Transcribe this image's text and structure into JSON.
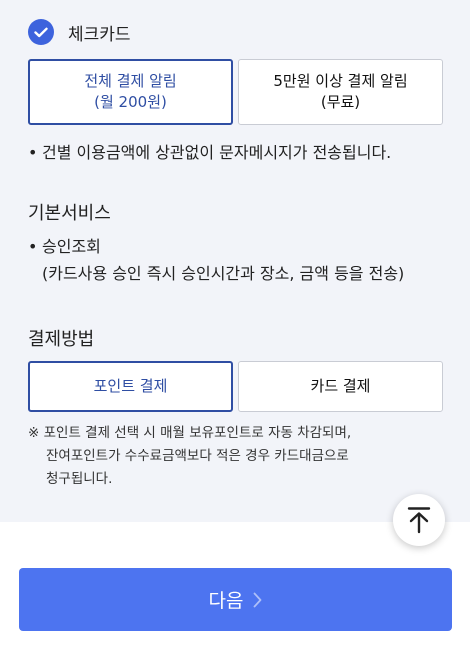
{
  "check_card": {
    "label": "체크카드",
    "checked": true,
    "icon": "checkmark-icon",
    "color": "#3d63dd"
  },
  "alert_options": [
    {
      "line1": "전체 결제 알림",
      "line2": "(월 200원)",
      "selected": true
    },
    {
      "line1": "5만원 이상 결제 알림",
      "line2": "(무료)",
      "selected": false
    }
  ],
  "alert_note": "건별 이용금액에 상관없이 문자메시지가 전송됩니다.",
  "basic_service": {
    "title": "기본서비스",
    "item": "승인조회",
    "detail": "(카드사용 승인 즉시 승인시간과 장소, 금액 등을 전송)"
  },
  "payment_method": {
    "title": "결제방법",
    "options": [
      {
        "label": "포인트 결제",
        "selected": true
      },
      {
        "label": "카드 결제",
        "selected": false
      }
    ],
    "note_line1": "※ 포인트 결제 선택 시 매월 보유포인트로 자동 차감되며,",
    "note_line2": "잔여포인트가 수수료금액보다 적은 경우 카드대금으로",
    "note_line3": "청구됩니다."
  },
  "scroll_top_icon": "arrow-up-icon",
  "next_button": {
    "label": "다음",
    "icon": "chevron-right-icon"
  },
  "colors": {
    "accent": "#2f4ea3",
    "primary_button": "#4d74f0",
    "background": "#f2f4f9"
  }
}
